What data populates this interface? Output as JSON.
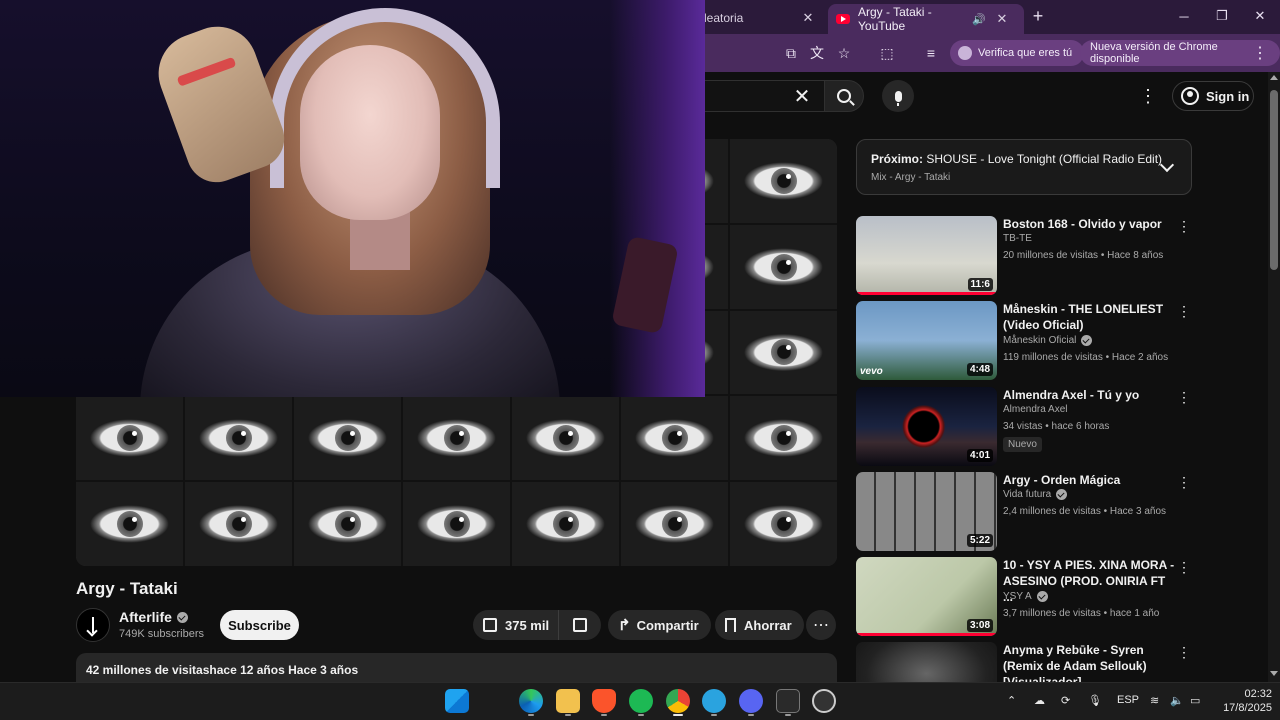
{
  "browser": {
    "tabs": [
      {
        "label": "leatoria",
        "active": false
      },
      {
        "label": "Argy - Tataki - YouTube",
        "active": true
      }
    ],
    "verify_label": "Verifica que eres tú",
    "update_label": "Nueva versión de Chrome disponible"
  },
  "youtube": {
    "signin_label": "Sign in",
    "video": {
      "title": "Argy - Tataki",
      "channel": "Afterlife",
      "subscribers": "749K subscribers",
      "subscribe_label": "Subscribe",
      "likes": "375 mil",
      "share_label": "Compartir",
      "save_label": "Ahorrar",
      "description_line": "42 millones de visitashace 12 años  Hace 3 años"
    },
    "up_next": {
      "prefix": "Próximo:",
      "title": "SHOUSE - Love Tonight (Official Radio Edit)",
      "mix": "Mix - Argy - Tataki"
    },
    "recommendations": [
      {
        "title": "Boston 168 - Olvido y vapor",
        "channel": "TB-TE",
        "verified": false,
        "meta": "20 millones de visitas • Hace 8 años",
        "duration": "11:6",
        "watched": 1.0,
        "badge": ""
      },
      {
        "title": "Måneskin - THE LONELIEST (Video Oficial)",
        "channel": "Måneskin Oficial",
        "verified": true,
        "meta": "119 millones de visitas • Hace 2 años",
        "duration": "4:48",
        "watched": 0.0,
        "badge": "vevo"
      },
      {
        "title": "Almendra Axel - Tú y yo",
        "channel": "Almendra Axel",
        "verified": false,
        "meta": "34 vistas • hace 6 horas",
        "duration": "4:01",
        "watched": 0.0,
        "badge": "Nuevo"
      },
      {
        "title": "Argy - Orden Mágica",
        "channel": "Vida futura",
        "verified": true,
        "meta": "2,4 millones de visitas • Hace 3 años",
        "duration": "5:22",
        "watched": 0.0,
        "badge": ""
      },
      {
        "title": "10 - YSY A PIES. XINA MORA - ASESINO (PROD. ONIRIA FT ...",
        "channel": "YSY A",
        "verified": true,
        "meta": "3,7 millones de visitas • hace 1 año",
        "duration": "3:08",
        "watched": 1.0,
        "badge": ""
      },
      {
        "title": "Anyma y Rebūke - Syren (Remix de Adam Sellouk) [Visualizador]",
        "channel": "",
        "verified": false,
        "meta": "",
        "duration": "",
        "watched": 0.0,
        "badge": ""
      }
    ]
  },
  "taskbar": {
    "language": "ESP",
    "time": "02:32",
    "date": "17/8/2025"
  },
  "colors": {
    "accent": "#ff0033",
    "chrome_frame": "#4a2b5e",
    "yt_bg": "#0f0f0f"
  }
}
